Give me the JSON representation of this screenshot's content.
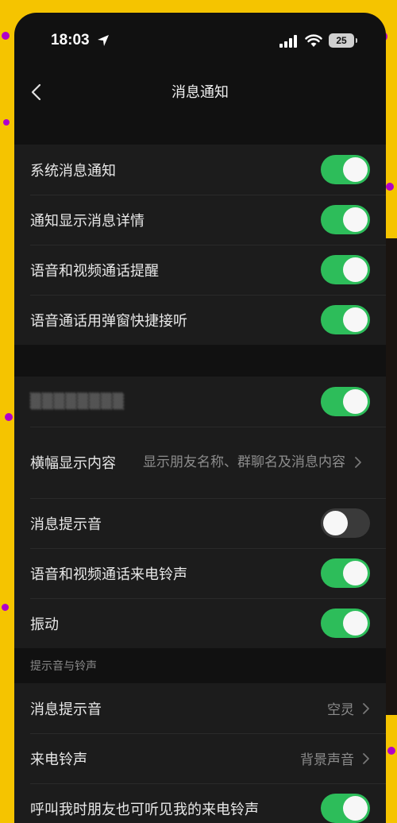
{
  "status_bar": {
    "time": "18:03",
    "battery": "25"
  },
  "nav": {
    "title": "消息通知"
  },
  "group1": [
    {
      "label": "系统消息通知",
      "toggle": true
    },
    {
      "label": "通知显示消息详情",
      "toggle": true
    },
    {
      "label": "语音和视频通话提醒",
      "toggle": true
    },
    {
      "label": "语音通话用弹窗快捷接听",
      "toggle": true
    }
  ],
  "group2": {
    "blurred_row": {
      "label": "▒▒▒▒▒▒▒▒",
      "toggle": true
    },
    "banner": {
      "label": "横幅显示内容",
      "value": "显示朋友名称、群聊名及消息内容"
    },
    "rows": [
      {
        "label": "消息提示音",
        "toggle": false
      },
      {
        "label": "语音和视频通话来电铃声",
        "toggle": true
      },
      {
        "label": "振动",
        "toggle": true
      }
    ]
  },
  "section3": {
    "header": "提示音与铃声",
    "message_tone": {
      "label": "消息提示音",
      "value": "空灵"
    },
    "ringtone": {
      "label": "来电铃声",
      "value": "背景声音"
    },
    "friends_hear": {
      "label": "呼叫我时朋友也可听见我的来电铃声",
      "toggle": true
    }
  },
  "colors": {
    "toggle_on": "#2dbd5a",
    "toggle_off": "#3a3a3a",
    "background": "#111111",
    "cell": "#1c1c1c"
  }
}
